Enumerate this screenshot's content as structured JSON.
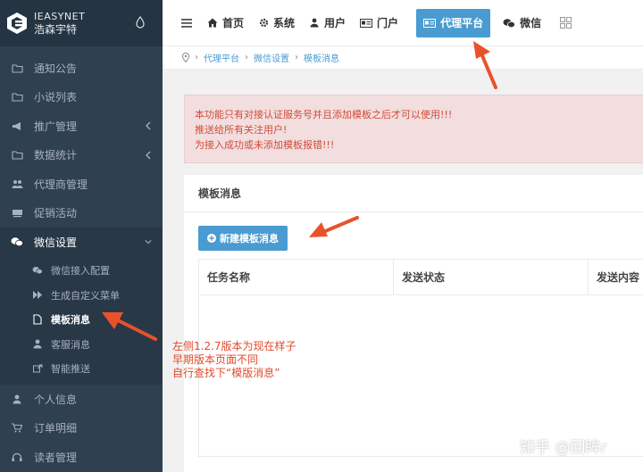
{
  "brand": {
    "name": "IEASYNET",
    "name_cn": "浩森宇特"
  },
  "sidebar": {
    "items": [
      {
        "label": "通知公告",
        "icon": "folder-icon"
      },
      {
        "label": "小说列表",
        "icon": "folder-icon"
      },
      {
        "label": "推广管理",
        "icon": "bullhorn-icon",
        "caret": true
      },
      {
        "label": "数据统计",
        "icon": "folder-icon",
        "caret": true
      },
      {
        "label": "代理商管理",
        "icon": "users-icon"
      },
      {
        "label": "促销活动",
        "icon": "ticket-icon"
      },
      {
        "label": "微信设置",
        "icon": "wechat-icon",
        "caret": true,
        "expanded": true
      }
    ],
    "sub_items": [
      {
        "label": "微信接入配置",
        "icon": "wechat-icon"
      },
      {
        "label": "生成自定义菜单",
        "icon": "forward-icon"
      },
      {
        "label": "模板消息",
        "icon": "file-icon",
        "current": true
      },
      {
        "label": "客服消息",
        "icon": "user-icon"
      },
      {
        "label": "智能推送",
        "icon": "share-icon"
      }
    ],
    "bottom_items": [
      {
        "label": "个人信息",
        "icon": "user-icon"
      },
      {
        "label": "订单明细",
        "icon": "cart-icon"
      },
      {
        "label": "读者管理",
        "icon": "headset-icon"
      }
    ]
  },
  "topnav": {
    "tabs": [
      {
        "label": "首页",
        "icon": "home-icon"
      },
      {
        "label": "系统",
        "icon": "gear-icon"
      },
      {
        "label": "用户",
        "icon": "user-icon"
      },
      {
        "label": "门户",
        "icon": "id-card-icon"
      },
      {
        "label": "代理平台",
        "icon": "id-card-icon",
        "active": true
      },
      {
        "label": "微信",
        "icon": "wechat-icon"
      }
    ]
  },
  "breadcrumb": {
    "items": [
      "代理平台",
      "微信设置",
      "模板消息"
    ]
  },
  "alert": {
    "lines": [
      "本功能只有对接认证服务号并且添加模板之后才可以使用!!!",
      "推送给所有关注用户!",
      "为接入成功或未添加模板报错!!!"
    ]
  },
  "panel": {
    "title": "模板消息",
    "new_button": "新建模板消息",
    "columns": [
      "任务名称",
      "发送状态",
      "发送内容"
    ]
  },
  "annotation": {
    "lines": [
      "左侧1.2.7版本为现在样子",
      "早期版本页面不同",
      "自行查找下“模版消息”"
    ]
  },
  "watermark": "知乎 @回眸r",
  "colors": {
    "sidebar": "#2f4050",
    "accent": "#4a9bd1",
    "alert_text": "#d24b3a",
    "arrow": "#e8522b"
  }
}
